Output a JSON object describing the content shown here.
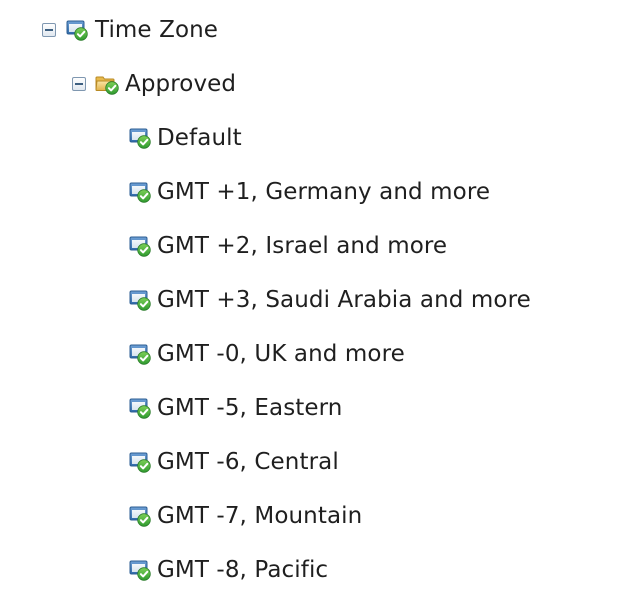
{
  "tree": {
    "root": {
      "label": "Time Zone",
      "icon": "policy-approved-icon",
      "expanded": true
    },
    "folder": {
      "label": "Approved",
      "icon": "folder-approved-icon",
      "expanded": true
    },
    "items": [
      {
        "label": "Default",
        "icon": "policy-approved-icon"
      },
      {
        "label": "GMT +1, Germany and more",
        "icon": "policy-approved-icon"
      },
      {
        "label": "GMT +2, Israel and more",
        "icon": "policy-approved-icon"
      },
      {
        "label": "GMT +3, Saudi Arabia and more",
        "icon": "policy-approved-icon"
      },
      {
        "label": "GMT -0, UK and more",
        "icon": "policy-approved-icon"
      },
      {
        "label": "GMT -5, Eastern",
        "icon": "policy-approved-icon"
      },
      {
        "label": "GMT -6, Central",
        "icon": "policy-approved-icon"
      },
      {
        "label": "GMT -7, Mountain",
        "icon": "policy-approved-icon"
      },
      {
        "label": "GMT -8, Pacific",
        "icon": "policy-approved-icon"
      }
    ]
  },
  "colors": {
    "text": "#1f1f1f",
    "window_blue": "#4a7fb8",
    "check_green": "#3aa23a",
    "folder_yellow": "#e9c46a",
    "toggle_border": "#7f97b0"
  }
}
